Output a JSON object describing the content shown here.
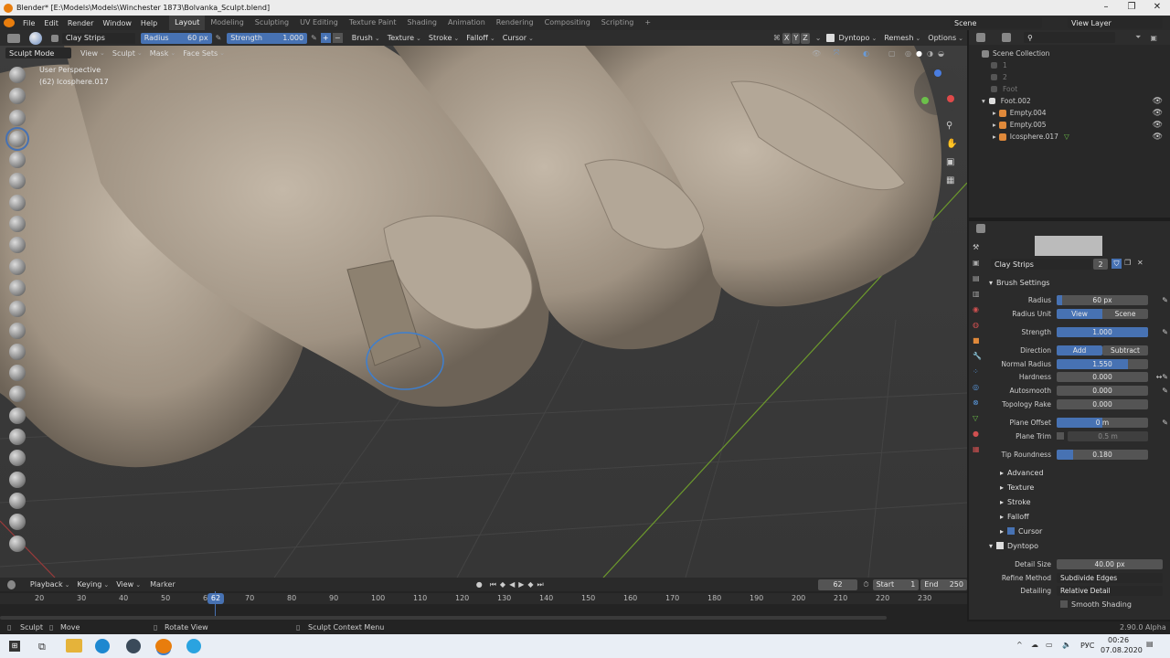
{
  "window": {
    "title": "Blender* [E:\\Models\\Models\\Winchester 1873\\Bolvanka_Sculpt.blend]"
  },
  "menu": {
    "items": [
      "File",
      "Edit",
      "Render",
      "Window",
      "Help"
    ],
    "workspaces": [
      "Layout",
      "Modeling",
      "Sculpting",
      "UV Editing",
      "Texture Paint",
      "Shading",
      "Animation",
      "Rendering",
      "Compositing",
      "Scripting"
    ],
    "active_workspace": "Layout",
    "scene": "Scene",
    "view_layer": "View Layer"
  },
  "toolheader": {
    "brush": "Clay Strips",
    "radius_label": "Radius",
    "radius_value": "60 px",
    "strength_label": "Strength",
    "strength_value": "1.000",
    "menus": [
      "Brush",
      "Texture",
      "Stroke",
      "Falloff",
      "Cursor"
    ],
    "axes": [
      "X",
      "Y",
      "Z"
    ],
    "dyntopo": "Dyntopo",
    "remesh": "Remesh",
    "options": "Options"
  },
  "vpheader": {
    "mode": "Sculpt Mode",
    "menus": [
      "View",
      "Sculpt",
      "Mask",
      "Face Sets"
    ]
  },
  "viewport": {
    "perspective": "User Perspective",
    "object": "(62) Icosphere.017"
  },
  "outliner": {
    "title": "Scene Collection",
    "rows": [
      {
        "name": "1",
        "indent": 0,
        "dim": true
      },
      {
        "name": "2",
        "indent": 0,
        "dim": true
      },
      {
        "name": "Foot",
        "indent": 0,
        "dim": true
      },
      {
        "name": "Foot.002",
        "indent": 0,
        "dim": false
      },
      {
        "name": "Empty.004",
        "indent": 1,
        "dim": false
      },
      {
        "name": "Empty.005",
        "indent": 1,
        "dim": false
      },
      {
        "name": "Icosphere.017",
        "indent": 1,
        "dim": false
      }
    ]
  },
  "props": {
    "brush_name": "Clay Strips",
    "brush_users": "2",
    "brush_settings": "Brush Settings",
    "radius": {
      "label": "Radius",
      "value": "60 px"
    },
    "radius_unit": {
      "label": "Radius Unit",
      "options": [
        "View",
        "Scene"
      ],
      "selected": "View"
    },
    "strength": {
      "label": "Strength",
      "value": "1.000",
      "fill": 1.0
    },
    "direction": {
      "label": "Direction",
      "options": [
        "Add",
        "Subtract"
      ],
      "selected": "Add"
    },
    "normal_radius": {
      "label": "Normal Radius",
      "value": "1.550",
      "fill": 0.78
    },
    "hardness": {
      "label": "Hardness",
      "value": "0.000",
      "fill": 0
    },
    "autosmooth": {
      "label": "Autosmooth",
      "value": "0.000",
      "fill": 0
    },
    "topology_rake": {
      "label": "Topology Rake",
      "value": "0.000",
      "fill": 0
    },
    "plane_offset": {
      "label": "Plane Offset",
      "value": "0 m",
      "fill": 0.5
    },
    "plane_trim": {
      "label": "Plane Trim",
      "value": "0.5 m"
    },
    "tip_roundness": {
      "label": "Tip Roundness",
      "value": "0.180",
      "fill": 0.18
    },
    "subpanels": [
      "Advanced",
      "Texture",
      "Stroke",
      "Falloff",
      "Cursor"
    ],
    "dyntopo": "Dyntopo",
    "detail_size": {
      "label": "Detail Size",
      "value": "40.00 px"
    },
    "refine_method": {
      "label": "Refine Method",
      "value": "Subdivide Edges"
    },
    "detailing": {
      "label": "Detailing",
      "value": "Relative Detail"
    },
    "smooth_shading": "Smooth Shading"
  },
  "timeline": {
    "menus": [
      "Playback",
      "Keying",
      "View",
      "Marker"
    ],
    "current": "62",
    "start_label": "Start",
    "start": "1",
    "end_label": "End",
    "end": "250",
    "ticks": [
      "20",
      "30",
      "40",
      "50",
      "60",
      "70",
      "80",
      "90",
      "100",
      "110",
      "120",
      "130",
      "140",
      "150",
      "160",
      "170",
      "180",
      "190",
      "200",
      "210",
      "220",
      "230"
    ]
  },
  "status": {
    "left1": "Sculpt",
    "left2": "Move",
    "left3": "Rotate View",
    "left4": "Sculpt Context Menu",
    "version": "2.90.0 Alpha"
  },
  "taskbar": {
    "lang": "РУС",
    "time": "00:26",
    "date": "07.08.2020"
  }
}
